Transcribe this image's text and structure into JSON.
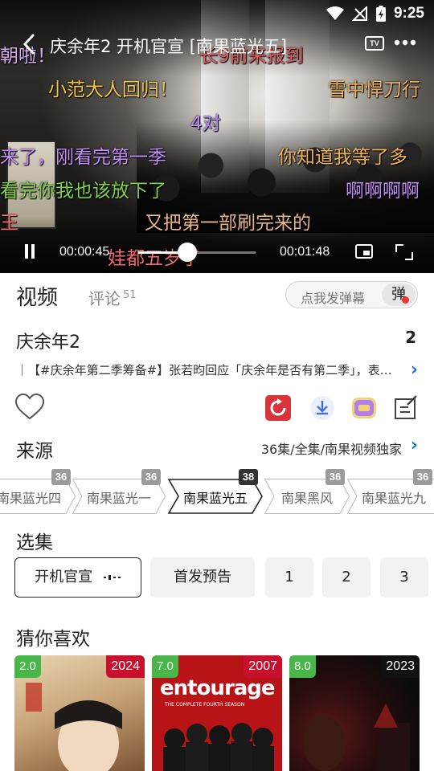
{
  "status_bar": {
    "time": "9:25"
  },
  "player": {
    "title": "庆余年2 开机官宣 [南果蓝光五]",
    "tv_label": "TV",
    "time_current": "00:00:45",
    "time_total": "00:01:48",
    "progress_fraction": 0.42,
    "danmaku": [
      {
        "text": "朝啦！",
        "color": "#d7aaf0"
      },
      {
        "text": "长9前来报到",
        "color": "#e05a5a"
      },
      {
        "text": "小范大人回归！",
        "color": "#f3c64a"
      },
      {
        "text": "雪中悍刀行",
        "color": "#f0b35a"
      },
      {
        "text": "4对",
        "color": "#b98af5"
      },
      {
        "text": "来了，刚看完第一季",
        "color": "#c28ef6"
      },
      {
        "text": "你知道我等了多",
        "color": "#f0b35a"
      },
      {
        "text": "看完你我也该放下了",
        "color": "#7fd14a"
      },
      {
        "text": "啊啊啊啊",
        "color": "#c28ef6"
      },
      {
        "text": "王",
        "color": "#ff6a6a"
      },
      {
        "text": "又把第一部刷完来的",
        "color": "#e8b48a"
      },
      {
        "text": "娃都五岁了",
        "color": "#ef6a6a"
      }
    ]
  },
  "tabs": {
    "video": "视频",
    "comments": "评论",
    "comments_count": "51"
  },
  "danmaku_input": {
    "placeholder": "点我发弹幕",
    "toggle_label": "弹"
  },
  "show": {
    "title": "庆余年2",
    "badge": "2",
    "news": "｜【#庆余年第二季筹备#】张若昀回应「庆余年是否有第二季」，表示..."
  },
  "source_section": {
    "label": "来源",
    "info": "36集/全集/南果视频独家",
    "sources": [
      {
        "label": "南果蓝光四",
        "count": "36",
        "active": false
      },
      {
        "label": "南果蓝光一",
        "count": "36",
        "active": false
      },
      {
        "label": "南果蓝光五",
        "count": "38",
        "active": true
      },
      {
        "label": "南果黑风",
        "count": "36",
        "active": false
      },
      {
        "label": "南果蓝光九",
        "count": "36",
        "active": false
      }
    ]
  },
  "episodes_section": {
    "label": "选集",
    "episodes": [
      "开机官宣",
      "首发预告",
      "1",
      "2",
      "3"
    ]
  },
  "recommend_section": {
    "label": "猜你喜欢",
    "items": [
      {
        "score": "2.0",
        "year": "2024",
        "poster_title": ""
      },
      {
        "score": "7.0",
        "year": "2007",
        "poster_title": "entourage",
        "poster_sub": "THE COMPLETE FOURTH SEASON"
      },
      {
        "score": "8.0",
        "year": "2023",
        "poster_title": ""
      }
    ]
  }
}
